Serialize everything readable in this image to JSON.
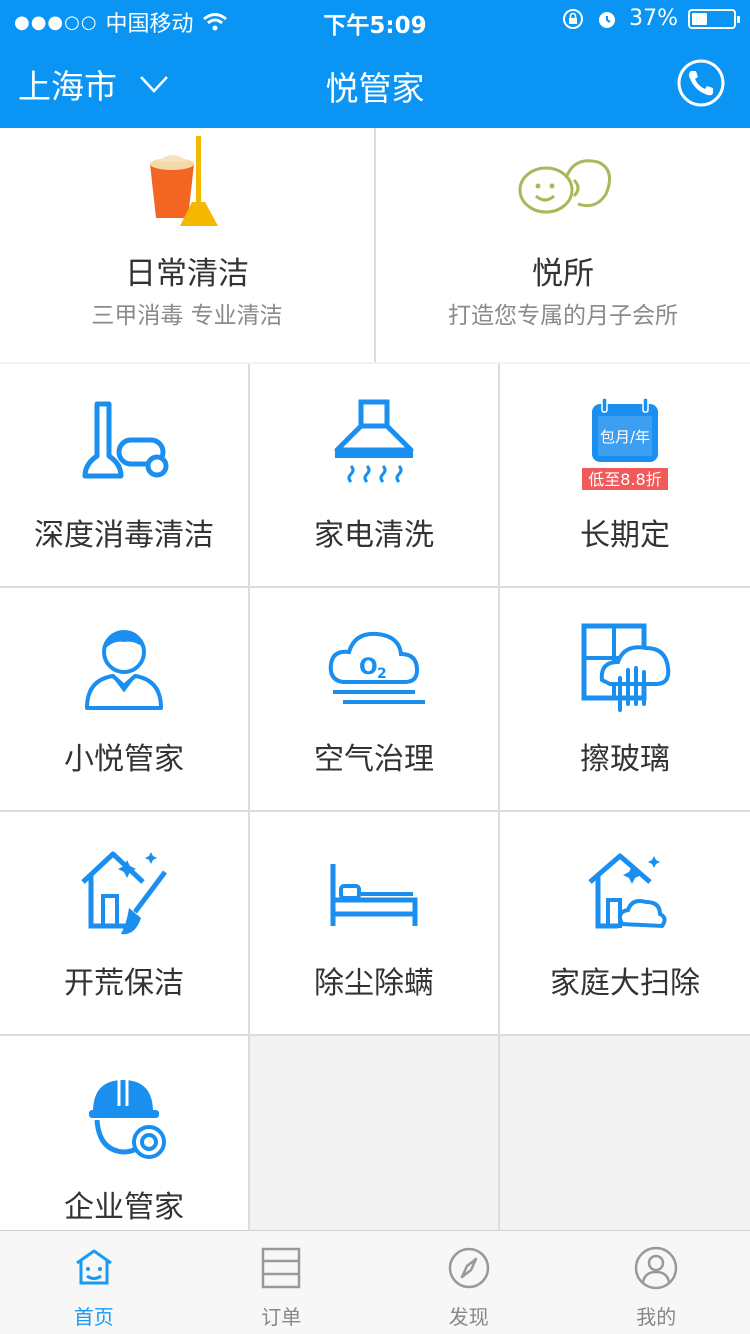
{
  "status_bar": {
    "signal": "●●●○○",
    "carrier": "中国移动",
    "time": "下午5:09",
    "battery_text": "37%",
    "battery_level": 0.37
  },
  "nav": {
    "city": "上海市",
    "title": "悦管家"
  },
  "top_services": [
    {
      "title": "日常清洁",
      "subtitle": "三甲消毒   专业清洁",
      "icon": "bucket-broom-icon"
    },
    {
      "title": "悦所",
      "subtitle": "打造您专属的月子会所",
      "icon": "twin-faces-icon"
    }
  ],
  "grid_services": [
    {
      "label": "深度消毒清洁",
      "icon": "vacuum-icon"
    },
    {
      "label": "家电清洗",
      "icon": "range-hood-icon"
    },
    {
      "label": "长期定",
      "icon": "calendar-icon",
      "calendar_text": "包月/年",
      "badge": "低至8.8折"
    },
    {
      "label": "小悦管家",
      "icon": "housekeeper-icon"
    },
    {
      "label": "空气治理",
      "icon": "o2-cloud-icon"
    },
    {
      "label": "擦玻璃",
      "icon": "window-cleaning-icon"
    },
    {
      "label": "开荒保洁",
      "icon": "house-broom-icon"
    },
    {
      "label": "除尘除螨",
      "icon": "bed-icon"
    },
    {
      "label": "家庭大扫除",
      "icon": "house-clean-icon"
    },
    {
      "label": "企业管家",
      "icon": "hardhat-worker-icon"
    }
  ],
  "tabs": [
    {
      "label": "首页",
      "icon": "home-tab-icon",
      "active": true
    },
    {
      "label": "订单",
      "icon": "orders-tab-icon",
      "active": false
    },
    {
      "label": "发现",
      "icon": "compass-tab-icon",
      "active": false
    },
    {
      "label": "我的",
      "icon": "profile-tab-icon",
      "active": false
    }
  ],
  "colors": {
    "brand_blue": "#0a95f5",
    "icon_blue": "#1a8ff0",
    "badge_red": "#f05a5a"
  }
}
